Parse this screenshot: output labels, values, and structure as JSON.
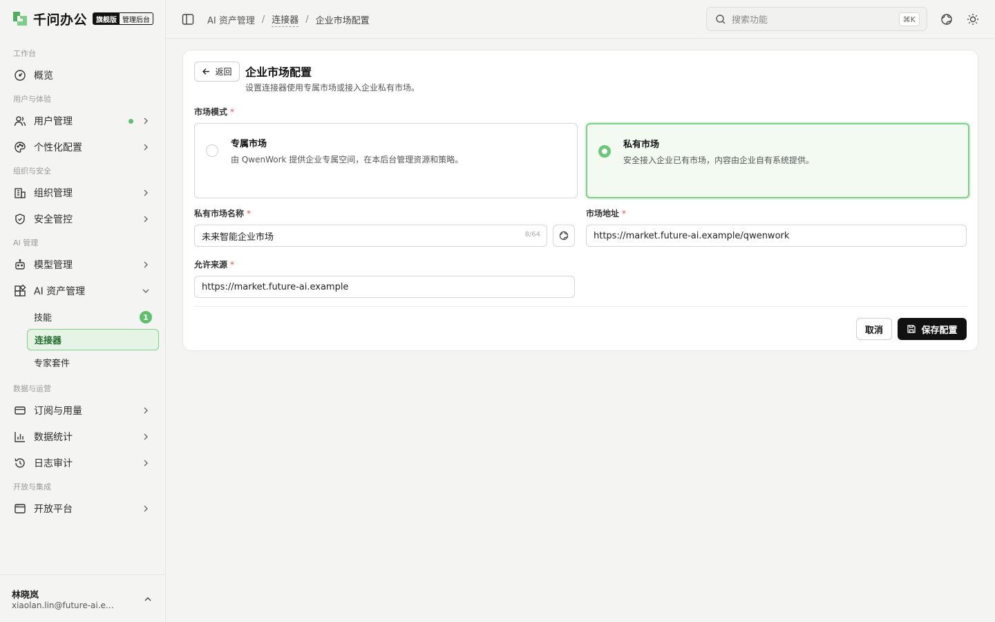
{
  "brand": {
    "name": "千问办公",
    "tag_primary": "旗舰版",
    "tag_secondary": "管理后台"
  },
  "sidebar": {
    "groups": [
      "工作台",
      "用户与体验",
      "组织与安全",
      "AI 管理",
      "数据与运营",
      "开放与集成"
    ],
    "items": [
      {
        "label": "概览",
        "icon": "dashboard-icon"
      },
      {
        "label": "用户管理",
        "icon": "users-icon",
        "has_dot": true
      },
      {
        "label": "个性化配置",
        "icon": "palette-icon"
      },
      {
        "label": "组织管理",
        "icon": "building-icon"
      },
      {
        "label": "安全管控",
        "icon": "shield-icon"
      },
      {
        "label": "模型管理",
        "icon": "bot-icon"
      },
      {
        "label": "AI 资产管理",
        "icon": "apps-icon",
        "expanded": true
      },
      {
        "label": "订阅与用量",
        "icon": "card-icon"
      },
      {
        "label": "数据统计",
        "icon": "bar-chart-icon"
      },
      {
        "label": "日志审计",
        "icon": "history-icon"
      },
      {
        "label": "开放平台",
        "icon": "window-icon"
      }
    ],
    "subitems": [
      {
        "label": "技能",
        "badge": "1"
      },
      {
        "label": "连接器",
        "active": true
      },
      {
        "label": "专家套件"
      }
    ]
  },
  "user": {
    "name": "林晓岚",
    "email": "xiaolan.lin@future-ai.ex..."
  },
  "topbar": {
    "breadcrumb": [
      "AI 资产管理",
      "连接器",
      "企业市场配置"
    ],
    "search_placeholder": "搜索功能",
    "search_shortcut": "⌘K"
  },
  "page": {
    "back_label": "返回",
    "title": "企业市场配置",
    "subtitle": "设置连接器使用专属市场或接入企业私有市场。",
    "market_mode_label": "市场模式",
    "options": [
      {
        "title": "专属市场",
        "desc": "由 QwenWork 提供企业专属空间，在本后台管理资源和策略。",
        "selected": false
      },
      {
        "title": "私有市场",
        "desc": "安全接入企业已有市场，内容由企业自有系统提供。",
        "selected": true
      }
    ],
    "name_label": "私有市场名称",
    "name_value": "未来智能企业市场",
    "name_count": "8/64",
    "url_label": "市场地址",
    "url_value": "https://market.future-ai.example/qwenwork",
    "origin_label": "允许来源",
    "origin_value": "https://market.future-ai.example",
    "cancel_label": "取消",
    "save_label": "保存配置"
  },
  "colors": {
    "accent": "#5fbf6c",
    "accent_light": "#e6f4e6",
    "primary_button": "#111111"
  }
}
